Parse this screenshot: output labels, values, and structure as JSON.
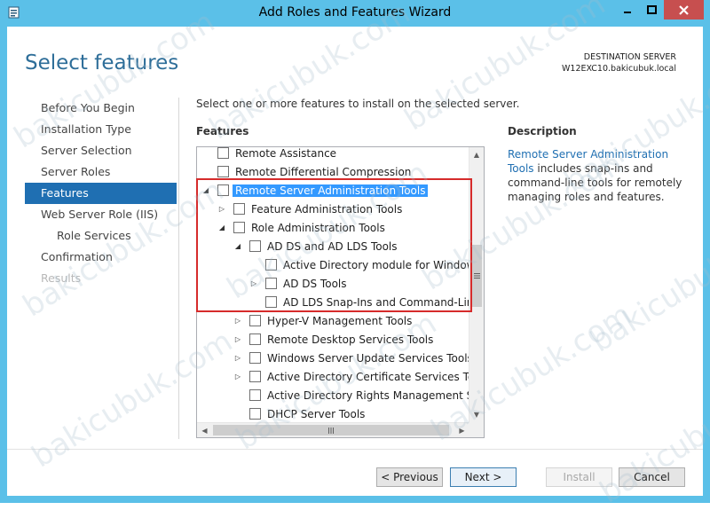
{
  "window": {
    "title": "Add Roles and Features Wizard"
  },
  "header": {
    "page_title": "Select features",
    "destination_label": "DESTINATION SERVER",
    "destination_server": "W12EXC10.bakicubuk.local"
  },
  "nav": {
    "items": [
      {
        "label": "Before You Begin",
        "state": "normal"
      },
      {
        "label": "Installation Type",
        "state": "normal"
      },
      {
        "label": "Server Selection",
        "state": "normal"
      },
      {
        "label": "Server Roles",
        "state": "normal"
      },
      {
        "label": "Features",
        "state": "active"
      },
      {
        "label": "Web Server Role (IIS)",
        "state": "normal"
      },
      {
        "label": "Role Services",
        "state": "sub"
      },
      {
        "label": "Confirmation",
        "state": "normal"
      },
      {
        "label": "Results",
        "state": "disabled"
      }
    ]
  },
  "main": {
    "instruction": "Select one or more features to install on the selected server.",
    "features_header": "Features",
    "tree": [
      {
        "label": "Remote Assistance",
        "expander": "",
        "checked": false
      },
      {
        "label": "Remote Differential Compression",
        "expander": "",
        "checked": false
      },
      {
        "label": "Remote Server Administration Tools",
        "expander": "expanded",
        "checked": false,
        "selected": true
      },
      {
        "label": "Feature Administration Tools",
        "expander": "collapsed",
        "checked": false
      },
      {
        "label": "Role Administration Tools",
        "expander": "expanded",
        "checked": false
      },
      {
        "label": "AD DS and AD LDS Tools",
        "expander": "expanded",
        "checked": false
      },
      {
        "label": "Active Directory module for Windows Po",
        "expander": "",
        "checked": false
      },
      {
        "label": "AD DS Tools",
        "expander": "collapsed",
        "checked": false
      },
      {
        "label": "AD LDS Snap-Ins and Command-Line To",
        "expander": "",
        "checked": false
      },
      {
        "label": "Hyper-V Management Tools",
        "expander": "collapsed",
        "checked": false
      },
      {
        "label": "Remote Desktop Services Tools",
        "expander": "collapsed",
        "checked": false
      },
      {
        "label": "Windows Server Update Services Tools",
        "expander": "collapsed",
        "checked": false
      },
      {
        "label": "Active Directory Certificate Services Tools",
        "expander": "collapsed",
        "checked": false
      },
      {
        "label": "Active Directory Rights Management Servic",
        "expander": "",
        "checked": false
      },
      {
        "label": "DHCP Server Tools",
        "expander": "",
        "checked": false
      }
    ]
  },
  "description": {
    "header": "Description",
    "link_text": "Remote Server Administration Tools",
    "body": " includes snap-ins and command-line tools for remotely managing roles and features."
  },
  "buttons": {
    "previous": "< Previous",
    "next": "Next >",
    "install": "Install",
    "cancel": "Cancel"
  },
  "watermark": "bakicubuk.com",
  "colors": {
    "titlebar": "#5bc0e8",
    "accent": "#1f6fb2",
    "highlight": "#d62b2b",
    "selection": "#3399ff"
  }
}
